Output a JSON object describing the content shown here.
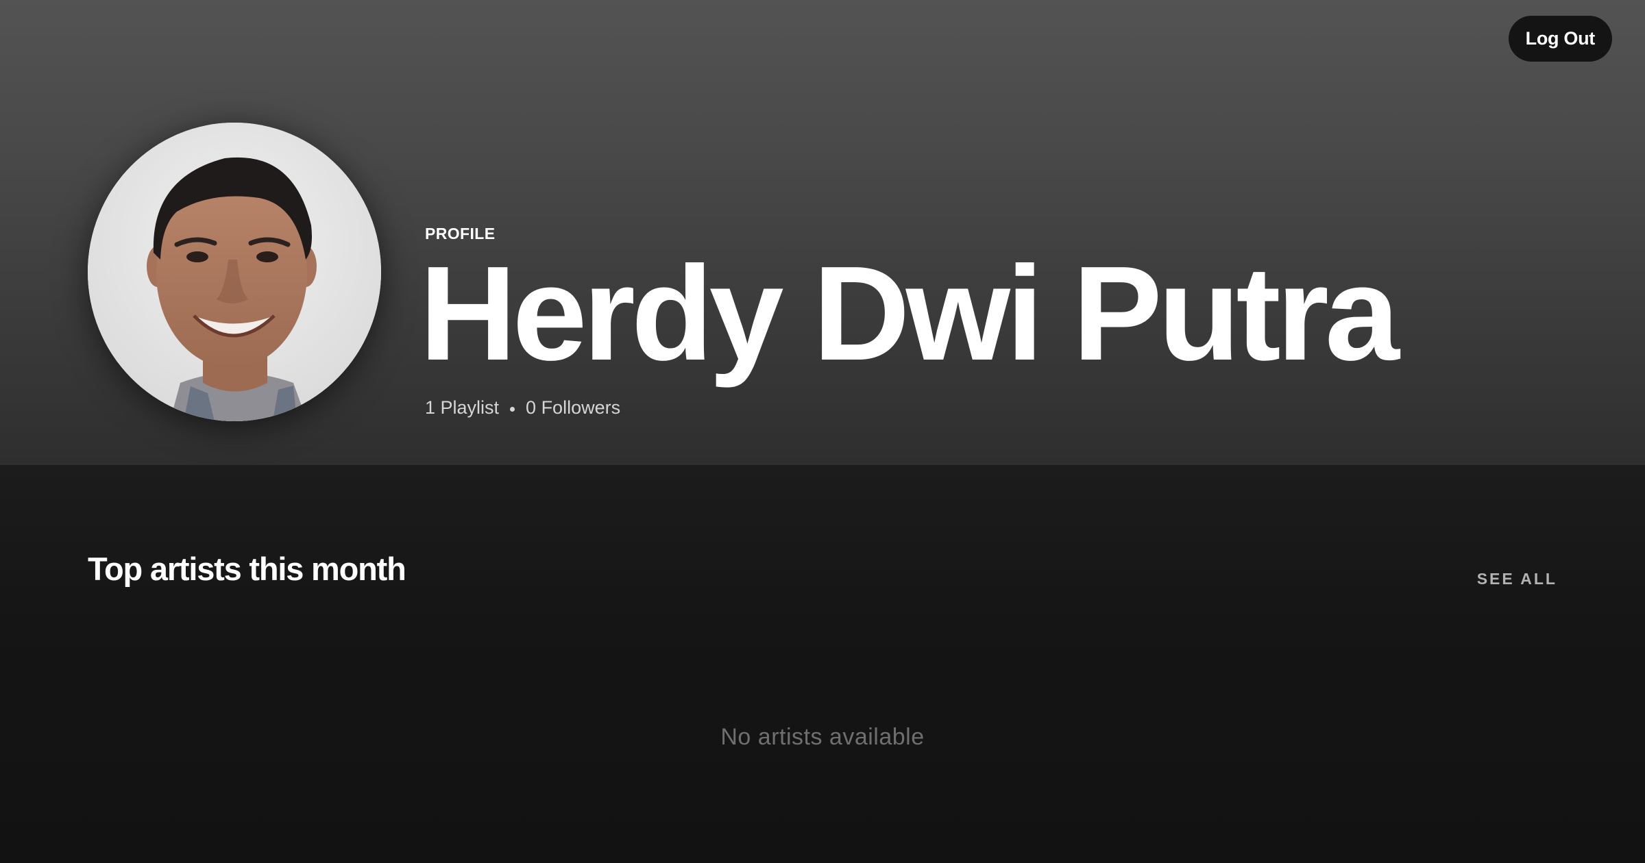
{
  "header": {
    "logout_label": "Log Out"
  },
  "profile": {
    "type_label": "PROFILE",
    "name": "Herdy Dwi Putra",
    "playlists": "1 Playlist",
    "followers": "0 Followers",
    "avatar_icon": "user-avatar-photo"
  },
  "top_artists": {
    "title": "Top artists this month",
    "see_all_label": "SEE ALL",
    "empty_message": "No artists available"
  },
  "colors": {
    "background": "#121212",
    "hero_gradient_top": "#535353",
    "button_bg": "#141414",
    "muted_text": "#b3b3b3",
    "empty_text": "#6f6f6f"
  }
}
